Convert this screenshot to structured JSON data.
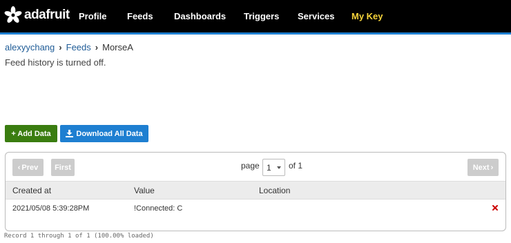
{
  "brand": {
    "name": "adafruit",
    "logo_icon": "adafruit-flower-icon"
  },
  "nav": {
    "profile": "Profile",
    "feeds": "Feeds",
    "dashboards": "Dashboards",
    "triggers": "Triggers",
    "services": "Services",
    "my_key": "My Key"
  },
  "colors": {
    "topbar": "#000000",
    "accent": "#1e7fd1",
    "my_key": "#f7d43b",
    "add_button": "#3a7d10",
    "download_button": "#1e7fd1",
    "delete": "#cc0000"
  },
  "breadcrumb": {
    "user": "alexyychang",
    "feeds": "Feeds",
    "current": "MorseA"
  },
  "notice": "Feed history is turned off.",
  "actions": {
    "add_data": "+ Add Data",
    "download_all": "Download All Data"
  },
  "pagination": {
    "prev": "Prev",
    "first": "First",
    "next": "Next",
    "page_label": "page",
    "current_page": "1",
    "of_label": "of 1"
  },
  "table": {
    "columns": [
      "Created at",
      "Value",
      "Location"
    ],
    "rows": [
      {
        "created_at": "2021/05/08 5:39:28PM",
        "value": "!Connected: C",
        "location": ""
      }
    ]
  },
  "footer": "Record 1 through 1 of 1 (100.00% loaded)"
}
